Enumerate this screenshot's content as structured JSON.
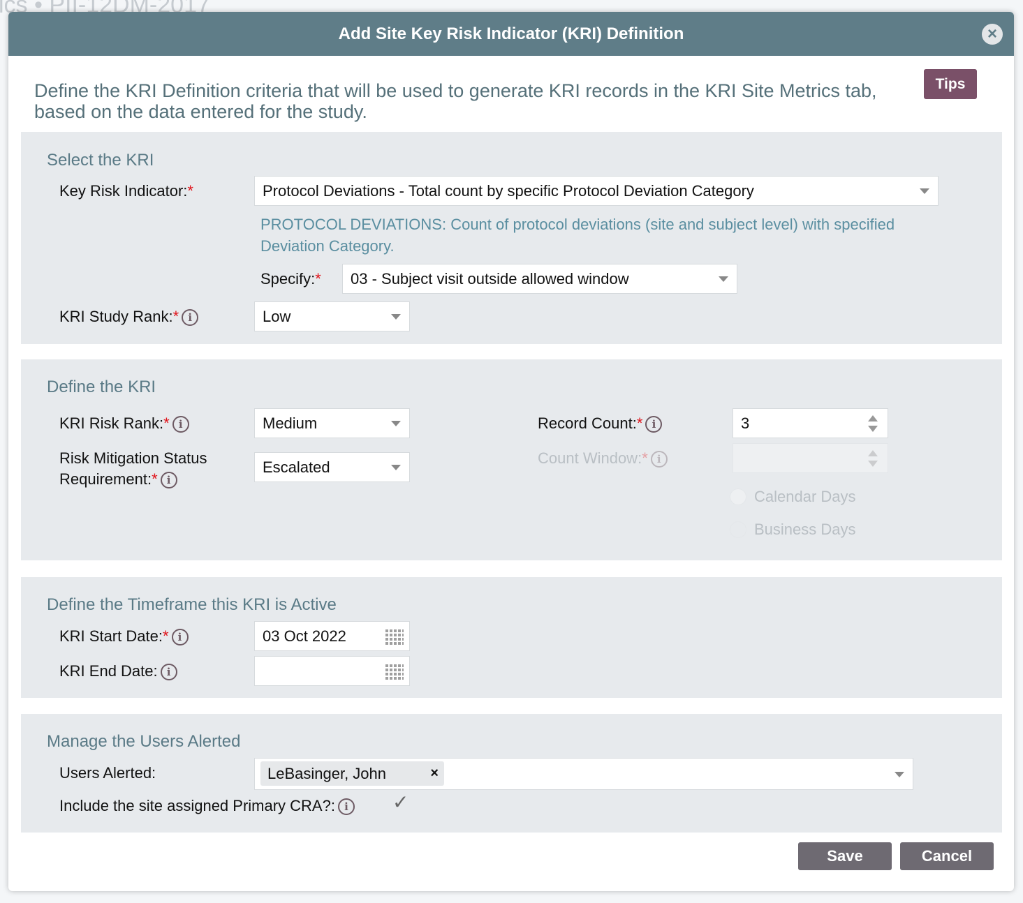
{
  "background": {
    "title": "ics • PII-12DM-2017"
  },
  "modal": {
    "title": "Add Site Key Risk Indicator (KRI) Definition",
    "intro": "Define the KRI Definition criteria that will be used to generate KRI records in the KRI Site Metrics tab, based on the data entered for the study.",
    "tips_label": "Tips",
    "close_icon": "close-circle-icon"
  },
  "select_kri": {
    "title": "Select the KRI",
    "kri_label": "Key Risk Indicator:",
    "kri_value": "Protocol Deviations - Total count by specific Protocol Deviation Category",
    "description": "PROTOCOL DEVIATIONS: Count of protocol deviations (site and subject level) with specified Deviation Category.",
    "specify_label": "Specify:",
    "specify_value": "03 - Subject visit outside allowed window",
    "study_rank_label": "KRI Study Rank:",
    "study_rank_value": "Low"
  },
  "define_kri": {
    "title": "Define the KRI",
    "risk_rank_label": "KRI Risk Rank:",
    "risk_rank_value": "Medium",
    "mitigation_label_1": "Risk Mitigation Status",
    "mitigation_label_2": "Requirement:",
    "mitigation_value": "Escalated",
    "record_count_label": "Record Count:",
    "record_count_value": "3",
    "count_window_label": "Count Window:",
    "count_window_value": "",
    "calendar_days": "Calendar Days",
    "business_days": "Business Days"
  },
  "timeframe": {
    "title": "Define the Timeframe this KRI is Active",
    "start_label": "KRI Start Date:",
    "start_value": "03 Oct 2022",
    "end_label": "KRI End Date:",
    "end_value": ""
  },
  "users": {
    "title": "Manage the Users Alerted",
    "users_label": "Users Alerted:",
    "chips": [
      "LeBasinger, John"
    ],
    "chip_remove": "×",
    "cra_label": "Include the site assigned Primary CRA?:",
    "cra_checked": true,
    "check_glyph": "✓"
  },
  "required_mark": "*",
  "info_glyph": "i",
  "footer": {
    "save": "Save",
    "cancel": "Cancel"
  },
  "colors": {
    "header": "#5f7d88",
    "tips": "#7a5068",
    "button": "#6e6a72",
    "required": "#e0131a"
  }
}
